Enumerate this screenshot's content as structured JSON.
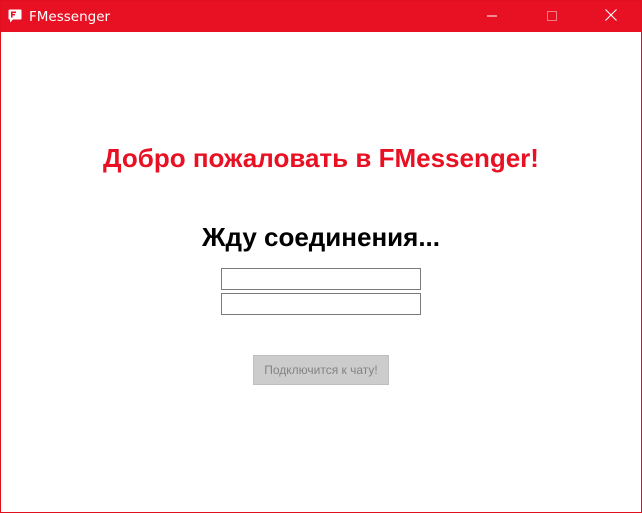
{
  "window": {
    "title": "FMessenger",
    "icon": "fmessenger-app-icon",
    "accent_color": "#e81123",
    "caption_buttons": [
      "minimize-icon",
      "maximize-icon",
      "close-icon"
    ]
  },
  "main": {
    "welcome_text": "Добро пожаловать в FMessenger!",
    "status_text": "Жду соединения...",
    "field_1": {
      "value": "",
      "placeholder": ""
    },
    "field_2": {
      "value": "",
      "placeholder": ""
    },
    "connect_button_label": "Подключится к чату!",
    "connect_button_state": "disabled"
  }
}
